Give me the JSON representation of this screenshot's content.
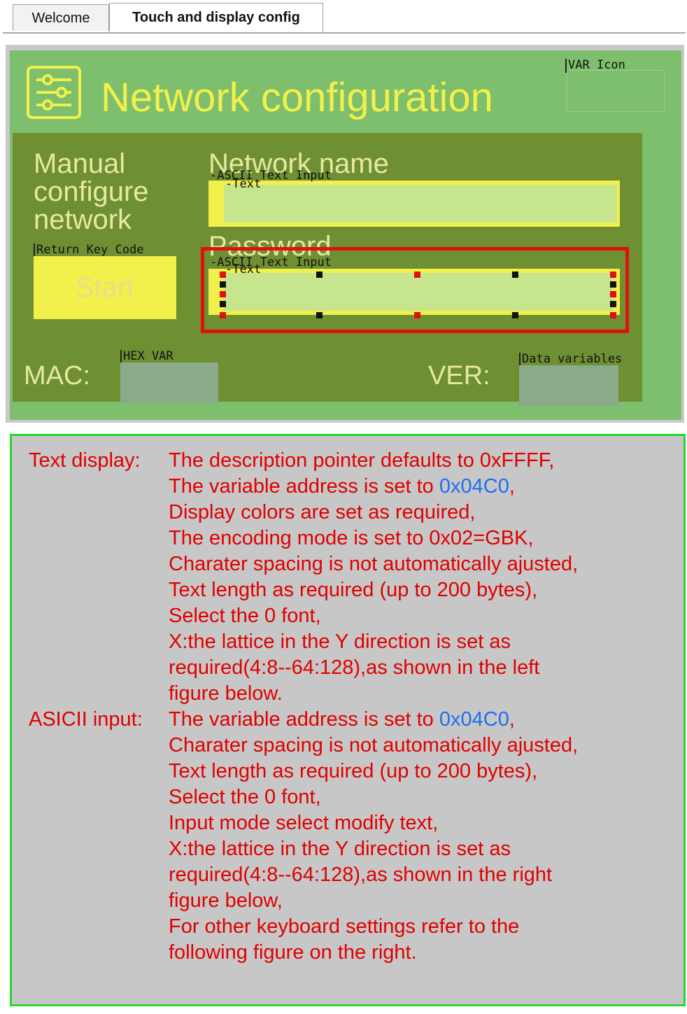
{
  "tabs": [
    {
      "label": "Welcome",
      "active": false
    },
    {
      "label": "Touch and display config",
      "active": true
    }
  ],
  "screen": {
    "title": "Network configuration",
    "title_icon": "sliders-icon",
    "var_icon_label": "VAR Icon",
    "manual_label": "Manual configure network",
    "network_name_label": "Network name",
    "password_label": "Password",
    "ascii_input_label_1": "ASCII Text Input",
    "text_label_1": "Text",
    "ascii_input_label_2": "ASCII Text Input",
    "text_label_2": "Text",
    "return_key_code_label": "Return Key Code",
    "start_button": "Start",
    "mac_label": "MAC:",
    "hex_var_label": "HEX VAR",
    "ver_label": "VER:",
    "data_variables_label": "Data variables"
  },
  "colors": {
    "screen_bg": "#7dbf6d",
    "inner_bg": "#6f8f33",
    "accent_yellow": "#f2f04a",
    "selection_red": "#e01010",
    "panel_border": "#29d629",
    "text_red": "#e00000",
    "text_blue": "#1e6ff0"
  },
  "description": {
    "text_display": {
      "heading": "Text display:",
      "l1": "The description pointer defaults to 0xFFFF,",
      "l2a": "The variable address is set to ",
      "l2b": "0x04C0",
      "l2c": ",",
      "l3": "Display colors are set as required,",
      "l4": "The encoding mode is set to 0x02=GBK,",
      "l5": "Charater spacing is not automatically ajusted,",
      "l6": "Text length as required (up to 200 bytes),",
      "l7": "Select the 0 font,",
      "l8": "X:the lattice in the Y direction is set as",
      "l9": "required(4:8--64:128),as shown in the left",
      "l10": "figure below."
    },
    "ascii_input": {
      "heading": "ASICII input:",
      "l1a": "The variable address is set to ",
      "l1b": "0x04C0",
      "l1c": ",",
      "l2": "Charater spacing is not automatically ajusted,",
      "l3": "Text length as required (up to 200 bytes),",
      "l4": "Select the 0 font,",
      "l5": "Input mode select modify text,",
      "l6": "X:the lattice in the Y direction is set as",
      "l7": "required(4:8--64:128),as shown in the right",
      "l8": "figure below,",
      "l9": "For other keyboard settings refer to the",
      "l10": "following figure on the right."
    }
  }
}
